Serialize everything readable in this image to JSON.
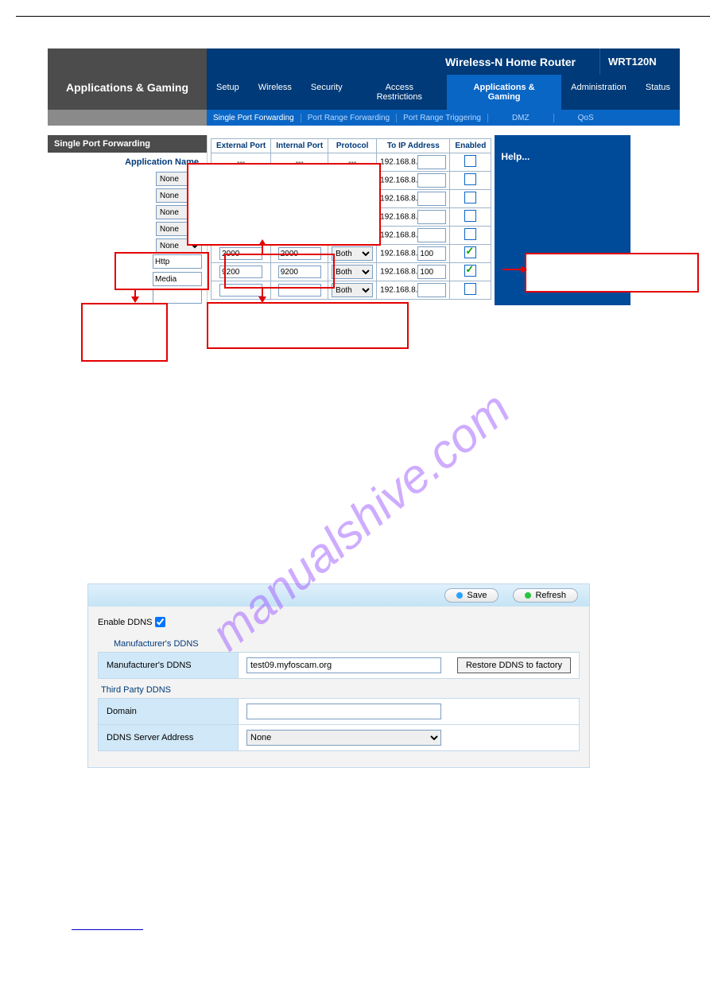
{
  "watermark": "manualshive.com",
  "router": {
    "title": "Wireless-N Home Router",
    "model": "WRT120N",
    "section": "Applications & Gaming",
    "nav": [
      "Setup",
      "Wireless",
      "Security",
      "Access Restrictions",
      "Applications & Gaming",
      "Administration",
      "Status"
    ],
    "subnav": [
      "Single Port Forwarding",
      "Port Range Forwarding",
      "Port Range Triggering",
      "DMZ",
      "QoS"
    ],
    "sidebar_header": "Single Port Forwarding",
    "app_name_label": "Application Name",
    "none_option": "None",
    "app_inputs": [
      "Http",
      "Media",
      ""
    ],
    "table": {
      "headers": [
        "External Port",
        "Internal Port",
        "Protocol",
        "To IP Address",
        "Enabled"
      ],
      "ip_prefix": "192.168.8.",
      "dash": "---",
      "rows": [
        {
          "ext": "---",
          "int": "---",
          "proto": "---",
          "ip": "",
          "enabled": false
        },
        {
          "ext": "",
          "int": "",
          "proto": "",
          "ip": "",
          "enabled": false
        },
        {
          "ext": "",
          "int": "",
          "proto": "",
          "ip": "",
          "enabled": false
        },
        {
          "ext": "",
          "int": "",
          "proto": "",
          "ip": "",
          "enabled": false
        },
        {
          "ext": "---",
          "int": "---",
          "proto": "",
          "ip": "",
          "enabled": false
        },
        {
          "ext": "2000",
          "int": "2000",
          "proto": "Both",
          "ip": "100",
          "enabled": true
        },
        {
          "ext": "9200",
          "int": "9200",
          "proto": "Both",
          "ip": "100",
          "enabled": true
        },
        {
          "ext": "",
          "int": "",
          "proto": "Both",
          "ip": "",
          "enabled": false
        }
      ]
    },
    "help": "Help..."
  },
  "ddns": {
    "save": "Save",
    "refresh": "Refresh",
    "enable_label": "Enable DDNS",
    "enable_checked": true,
    "manuf_section": "Manufacturer's DDNS",
    "manuf_label": "Manufacturer's DDNS",
    "manuf_value": "test09.myfoscam.org",
    "restore_btn": "Restore DDNS to factory",
    "third_section": "Third Party DDNS",
    "domain_label": "Domain",
    "domain_value": "",
    "server_label": "DDNS Server Address",
    "server_value": "None"
  }
}
